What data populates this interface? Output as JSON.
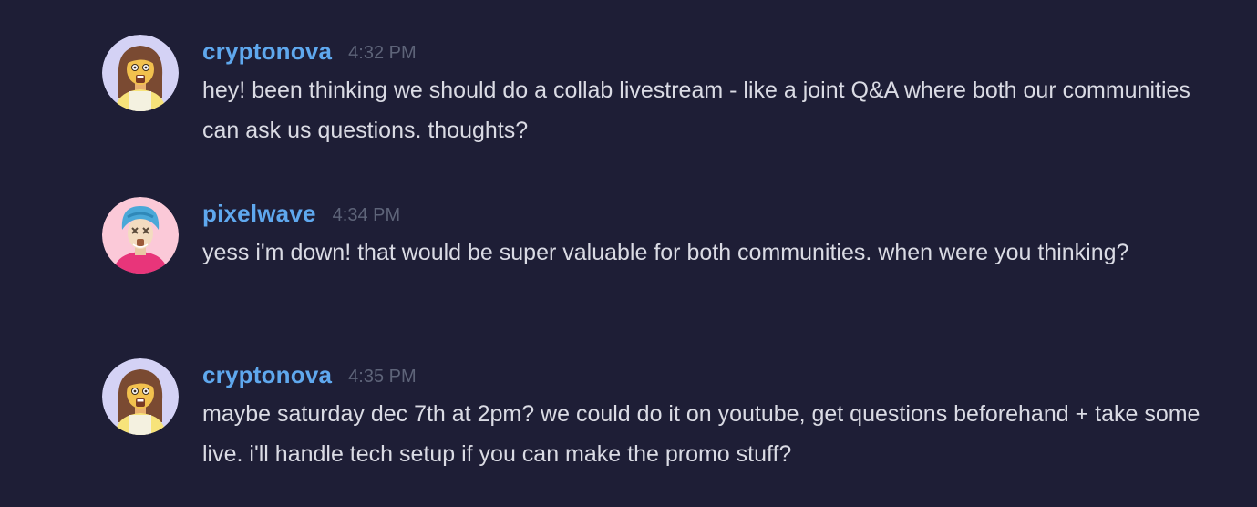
{
  "messages": [
    {
      "username": "cryptonova",
      "time": "4:32 PM",
      "avatar": "woman-avatar-icon",
      "text": "hey! been thinking we should do a collab livestream - like a joint Q&A where both our communities can ask us questions. thoughts?"
    },
    {
      "username": "pixelwave",
      "time": "4:34 PM",
      "avatar": "turban-avatar-icon",
      "text": "yess i'm down! that would be super valuable for both communities. when were you thinking?"
    },
    {
      "username": "cryptonova",
      "time": "4:35 PM",
      "avatar": "woman-avatar-icon",
      "text": "maybe saturday dec 7th at 2pm? we could do it on youtube, get questions beforehand + take some live. i'll handle tech setup if you can make the promo stuff?"
    }
  ],
  "colors": {
    "background": "#1e1e36",
    "username": "#5fa8ee",
    "timestamp": "#5e6479",
    "message_text": "#dadbe4"
  }
}
